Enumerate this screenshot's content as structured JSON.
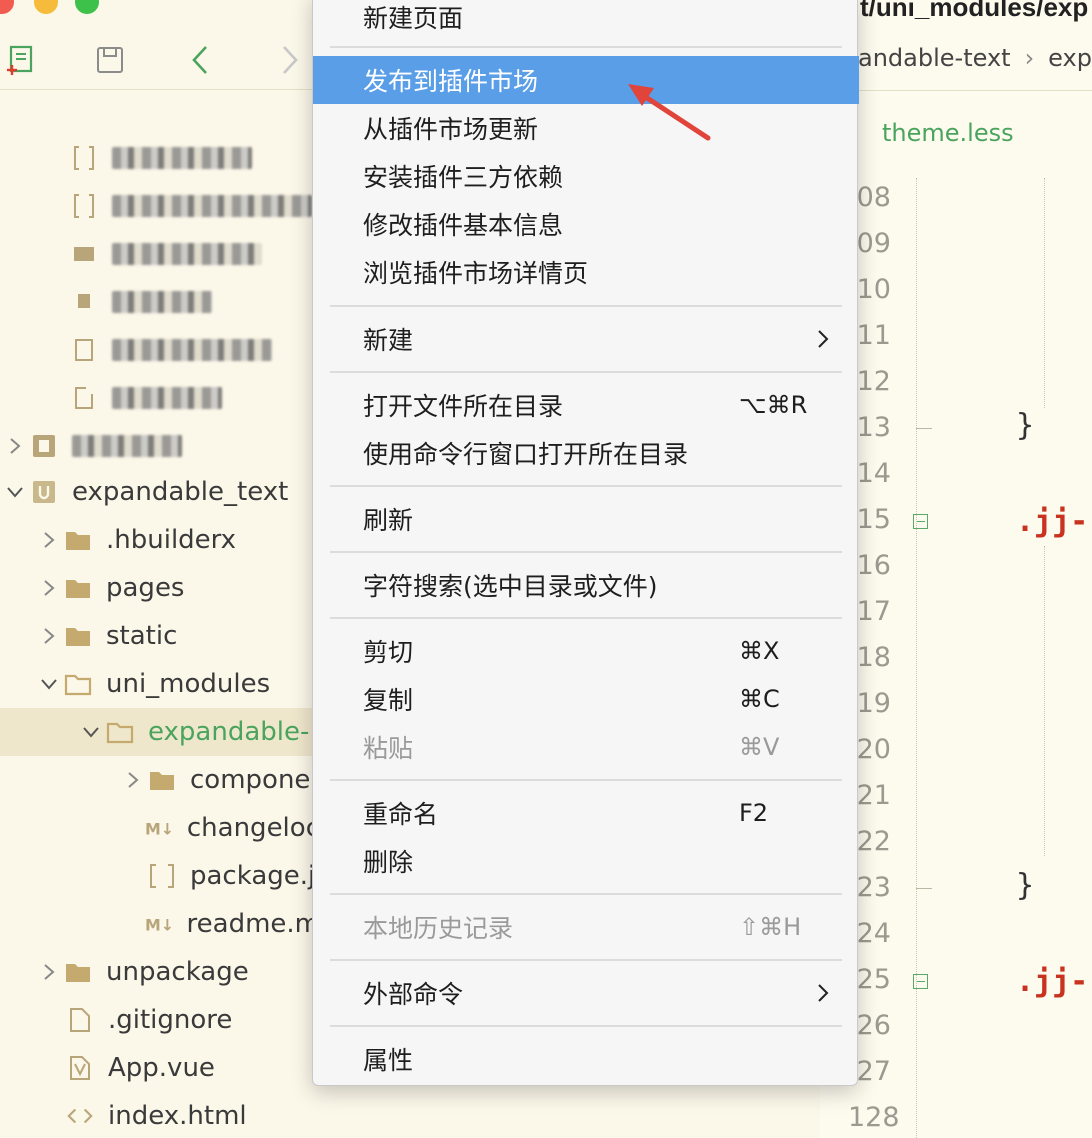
{
  "editor": {
    "path_text": "t/uni_modules/exp",
    "breadcrumb": [
      "andable-text",
      "exp"
    ],
    "tab_name": "theme.less",
    "line_numbers": [
      ".08",
      ".09",
      ".10",
      ".11",
      ".12",
      ".13",
      ".14",
      ".15",
      ".16",
      ".17",
      ".18",
      ".19",
      ".20",
      ".21",
      ".22",
      ".23",
      ".24",
      ".25",
      ".26",
      ".27",
      "128"
    ],
    "code_tokens": {
      "brace1": "}",
      "selector1": ".jj-",
      "brace2": "}",
      "selector2": ".jj-"
    }
  },
  "tree": {
    "root": "expandable_text",
    "items": [
      {
        "label": ".hbuilderx"
      },
      {
        "label": "pages"
      },
      {
        "label": "static"
      },
      {
        "label": "uni_modules"
      },
      {
        "label": "expandable-"
      },
      {
        "label": "compone"
      },
      {
        "label": "changeloc"
      },
      {
        "label": "package.j"
      },
      {
        "label": "readme.m"
      },
      {
        "label": "unpackage"
      },
      {
        "label": ".gitignore"
      },
      {
        "label": "App.vue"
      },
      {
        "label": "index.html"
      }
    ]
  },
  "menu": {
    "items": {
      "new_page": "新建页面",
      "publish": "发布到插件市场",
      "update": "从插件市场更新",
      "install_deps": "安装插件三方依赖",
      "edit_info": "修改插件基本信息",
      "browse": "浏览插件市场详情页",
      "new": "新建",
      "open_dir": "打开文件所在目录",
      "open_dir_sc": "⌥⌘R",
      "open_terminal": "使用命令行窗口打开所在目录",
      "refresh": "刷新",
      "search": "字符搜索(选中目录或文件)",
      "cut": "剪切",
      "cut_sc": "⌘X",
      "copy": "复制",
      "copy_sc": "⌘C",
      "paste": "粘贴",
      "paste_sc": "⌘V",
      "rename": "重命名",
      "rename_sc": "F2",
      "delete": "删除",
      "history": "本地历史记录",
      "history_sc": "⇧⌘H",
      "external": "外部命令",
      "properties": "属性"
    }
  },
  "colors": {
    "menu_highlight": "#5a9ee8",
    "accent_green": "#4aa45e",
    "arrow_red": "#e0443a",
    "selector_red": "#c8321f"
  }
}
